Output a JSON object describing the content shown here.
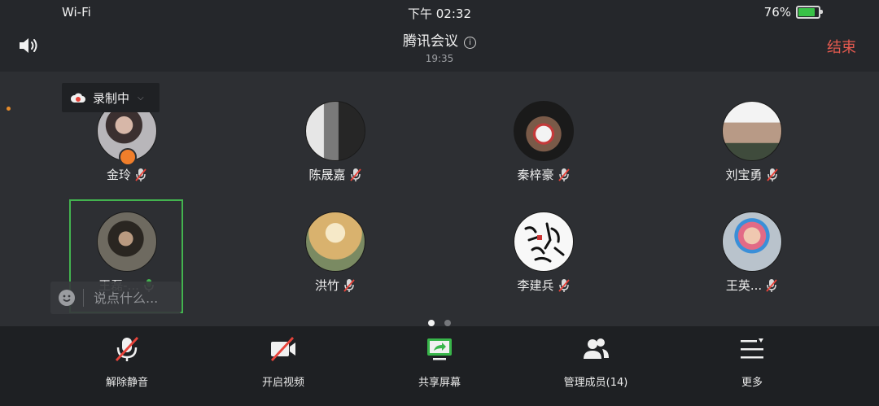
{
  "status_bar": {
    "network": "Wi-Fi",
    "time": "下午 02:32",
    "battery": "76%",
    "battery_level": 0.76
  },
  "header": {
    "title": "腾讯会议",
    "duration": "19:35",
    "end_label": "结束"
  },
  "recording": {
    "label": "录制中"
  },
  "participants": [
    {
      "name": "金玲",
      "mic": "muted",
      "avatar": "woman-photo",
      "host": true
    },
    {
      "name": "陈晟嘉",
      "mic": "muted",
      "avatar": "bw-window-photo"
    },
    {
      "name": "秦梓豪",
      "mic": "muted",
      "avatar": "basketball-player"
    },
    {
      "name": "刘宝勇",
      "mic": "muted",
      "avatar": "screaming-face"
    },
    {
      "name": "王磊-...",
      "mic": "on",
      "avatar": "man-portrait",
      "active": true
    },
    {
      "name": "洪竹",
      "mic": "muted",
      "avatar": "painted-landscape"
    },
    {
      "name": "李建兵",
      "mic": "muted",
      "avatar": "calligraphy"
    },
    {
      "name": "王英...",
      "mic": "muted",
      "avatar": "cartoon-character"
    }
  ],
  "chat": {
    "placeholder": "说点什么..."
  },
  "pager": {
    "pages": 2,
    "current": 1
  },
  "toolbar": {
    "unmute": "解除静音",
    "video": "开启视频",
    "share": "共享屏幕",
    "members": "管理成员(14)",
    "more": "更多"
  },
  "colors": {
    "end": "#e55a4f",
    "active_border": "#43b34f",
    "share": "#38b54a",
    "recording_dot": "#e8433a"
  }
}
